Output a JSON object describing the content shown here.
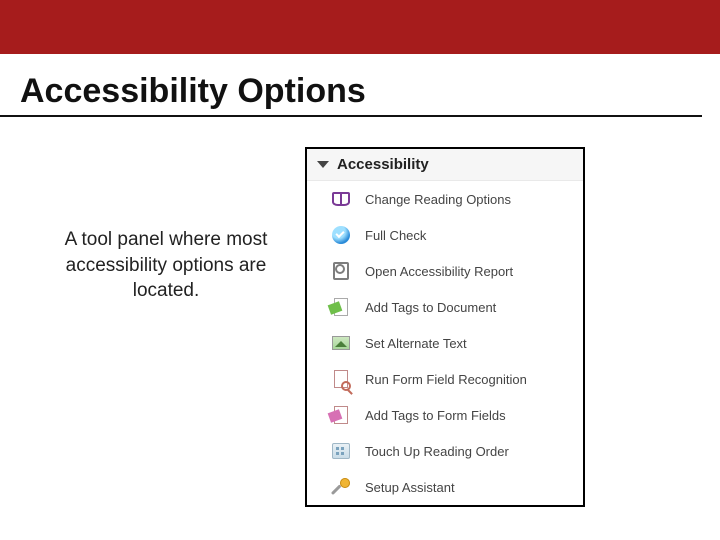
{
  "header": {
    "title": "Accessibility Options"
  },
  "description": "A tool panel where most accessibility options are located.",
  "panel": {
    "title": "Accessibility",
    "items": [
      {
        "label": "Change Reading Options"
      },
      {
        "label": "Full Check"
      },
      {
        "label": "Open Accessibility Report"
      },
      {
        "label": "Add Tags to Document"
      },
      {
        "label": "Set Alternate Text"
      },
      {
        "label": "Run Form Field Recognition"
      },
      {
        "label": "Add Tags to Form Fields"
      },
      {
        "label": "Touch Up Reading Order"
      },
      {
        "label": "Setup Assistant"
      }
    ]
  }
}
